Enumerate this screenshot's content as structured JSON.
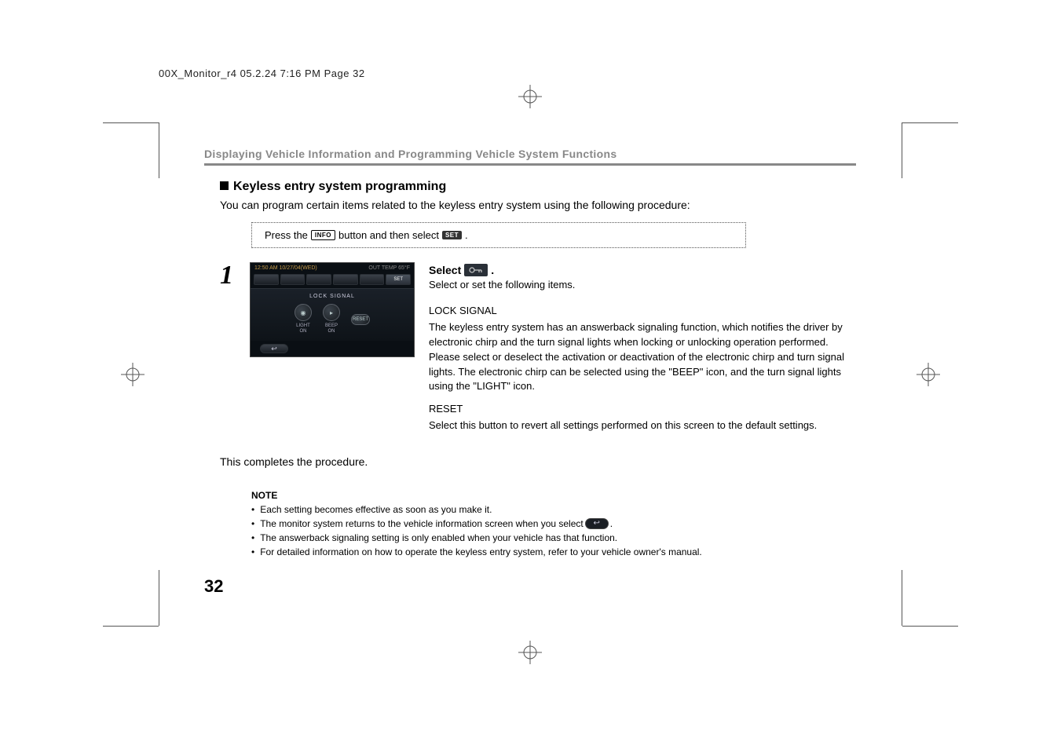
{
  "header_line": "00X_Monitor_r4  05.2.24  7:16 PM  Page 32",
  "section_header": "Displaying Vehicle Information and Programming Vehicle System Functions",
  "sub_heading": "Keyless entry system programming",
  "intro": "You can program certain items related to the keyless entry system using the following procedure:",
  "instr": {
    "pre": "Press the",
    "info_btn": "INFO",
    "mid": "button and then select",
    "set_btn": "SET",
    "post": "."
  },
  "step_num": "1",
  "screen": {
    "time": "12:50 AM 10/27/04(WED)",
    "temp": "OUT TEMP  65°F",
    "icons_last": "SET",
    "body_title": "LOCK SIGNAL",
    "light_label1": "LIGHT",
    "light_label2": "ON",
    "beep_label1": "BEEP",
    "beep_label2": "ON",
    "reset": "RESET",
    "back": "↩"
  },
  "select_label": "Select",
  "select_desc": "Select or set the following items.",
  "lock_signal_title": "LOCK SIGNAL",
  "lock_signal_body": "The keyless entry system has an answerback signaling function, which notifies the driver by electronic chirp and the turn signal lights when locking or unlocking operation performed. Please select or deselect the activation or deactivation of the electronic chirp and turn signal lights. The electronic chirp can be selected using the \"BEEP\" icon, and the turn signal lights using the \"LIGHT\" icon.",
  "reset_title": "RESET",
  "reset_body": "Select this button to revert all settings performed on this screen to the default settings.",
  "complete": "This completes the procedure.",
  "note_heading": "NOTE",
  "notes": {
    "n1": "Each setting becomes effective as soon as you make it.",
    "n2a": "The monitor system returns to the vehicle information screen when you select",
    "n2b": ".",
    "n3": "The answerback signaling setting is only enabled when your vehicle has that function.",
    "n4": "For detailed information on how to operate the keyless entry system, refer to your vehicle owner's manual."
  },
  "page_num": "32",
  "return_glyph": "↩"
}
